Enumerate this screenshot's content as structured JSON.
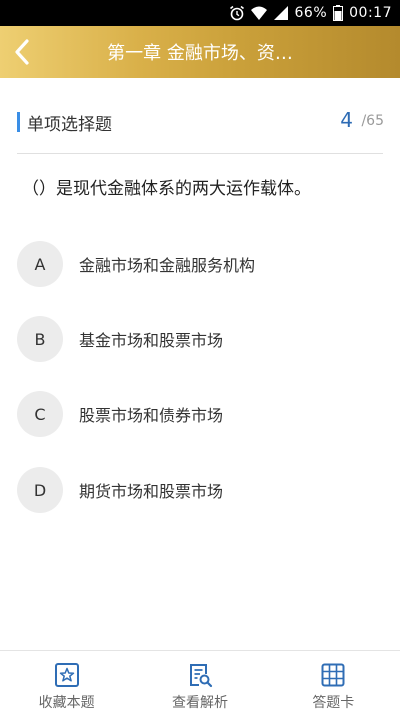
{
  "status_bar": {
    "battery": "66%",
    "time": "00:17"
  },
  "header": {
    "title": "第一章 金融市场、资…"
  },
  "question_type": {
    "label": "单项选择题",
    "current": "4",
    "total": "/65"
  },
  "question": {
    "text": "（）是现代金融体系的两大运作载体。"
  },
  "options": [
    {
      "letter": "A",
      "text": "金融市场和金融服务机构"
    },
    {
      "letter": "B",
      "text": "基金市场和股票市场"
    },
    {
      "letter": "C",
      "text": "股票市场和债券市场"
    },
    {
      "letter": "D",
      "text": "期货市场和股票市场"
    }
  ],
  "bottom_bar": {
    "favorite": "收藏本题",
    "analysis": "查看解析",
    "answer_card": "答题卡"
  },
  "colors": {
    "accent": "#3a8ee6",
    "header_gold": "#d9b049",
    "icon_blue": "#2f6db5"
  }
}
